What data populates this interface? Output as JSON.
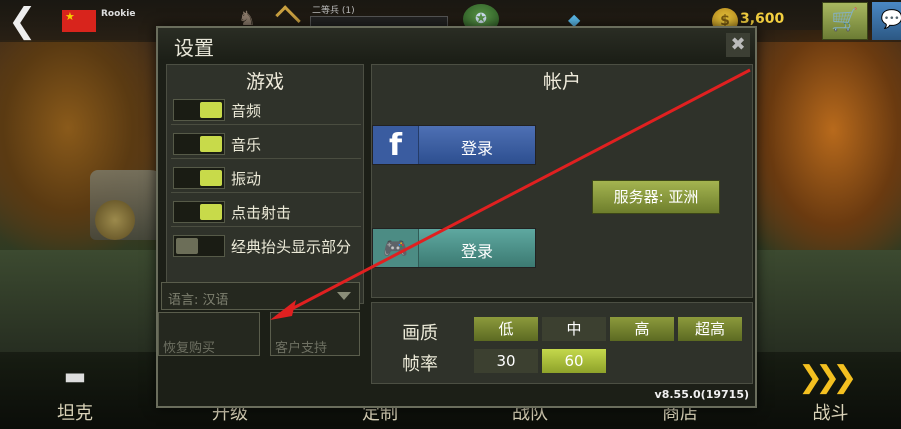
{
  "topbar": {
    "player_rank": "Rookie",
    "xp_label": "二等兵 (1)",
    "coins": "3,600"
  },
  "nav": {
    "tank": "坦克",
    "upgrade": "升级",
    "customize": "定制",
    "squad": "战队",
    "shop": "商店",
    "battle": "战斗"
  },
  "dialog": {
    "title": "设置",
    "game_panel": {
      "title": "游戏",
      "toggles": [
        {
          "label": "音频",
          "state": "on"
        },
        {
          "label": "音乐",
          "state": "on"
        },
        {
          "label": "振动",
          "state": "on"
        },
        {
          "label": "点击射击",
          "state": "on"
        },
        {
          "label": "经典抬头显示部分",
          "state": "off"
        }
      ],
      "language": "语言: 汉语",
      "restore": "恢复购买",
      "support": "客户支持"
    },
    "account_panel": {
      "title": "帐户",
      "facebook_login": "登录",
      "gamepad_login": "登录",
      "server": "服务器: 亚洲"
    },
    "graphics": {
      "quality_label": "画质",
      "framerate_label": "帧率",
      "quality_options": [
        "低",
        "中",
        "高",
        "超高"
      ],
      "quality_selected": "中",
      "framerate_options": [
        "30",
        "60"
      ],
      "framerate_selected": "60"
    },
    "version": "v8.55.0(19715)"
  },
  "colors": {
    "accent_green": "#c8da4a",
    "facebook_blue": "#3a5ca0",
    "gamepad_teal": "#4c8c84",
    "annotation_red": "#e02020"
  }
}
